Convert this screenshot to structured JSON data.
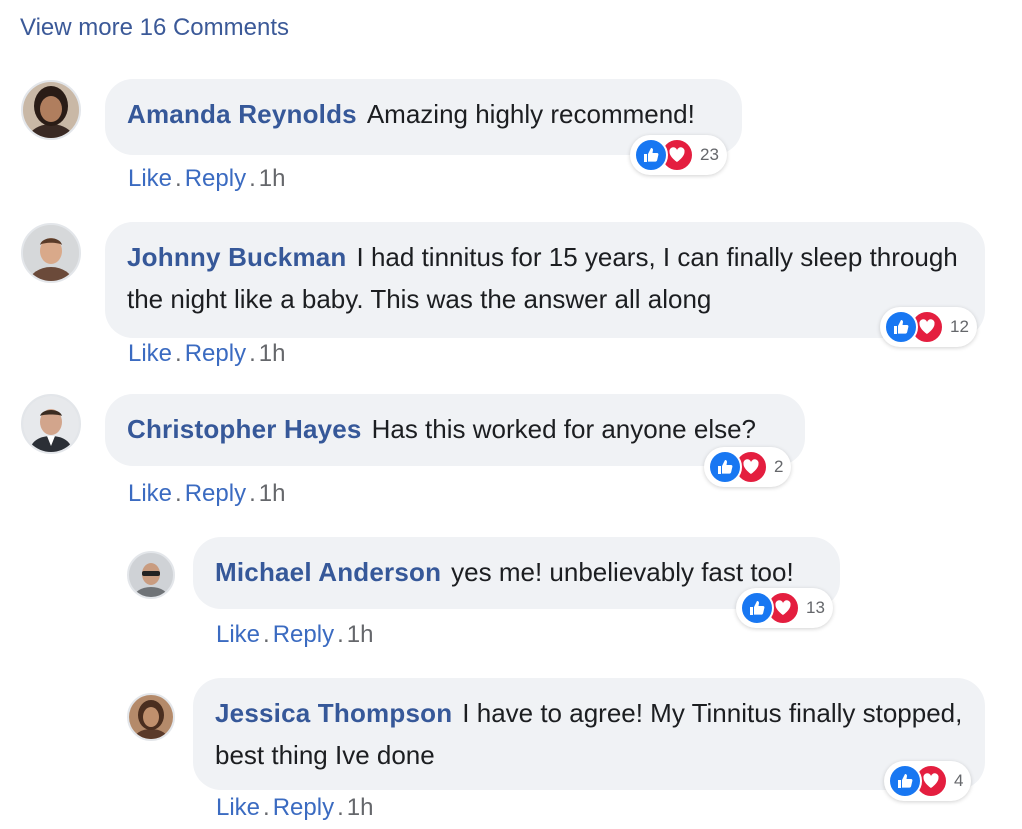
{
  "view_more": "View more 16 Comments",
  "separator": ".",
  "comments": [
    {
      "author": "Amanda Reynolds",
      "text": "Amazing highly recommend!",
      "reaction_count": "23",
      "like": "Like",
      "reply": "Reply",
      "time": "1h"
    },
    {
      "author": "Johnny Buckman",
      "text": "I had tinnitus for 15 years, I can finally sleep through the night like a baby. This was the answer all along",
      "reaction_count": "12",
      "like": "Like",
      "reply": "Reply",
      "time": "1h"
    },
    {
      "author": "Christopher Hayes",
      "text": "Has this worked for anyone else?",
      "reaction_count": "2",
      "like": "Like",
      "reply": "Reply",
      "time": "1h"
    },
    {
      "author": "Michael Anderson",
      "text": "yes me! unbelievably fast too!",
      "reaction_count": "13",
      "like": "Like",
      "reply": "Reply",
      "time": "1h"
    },
    {
      "author": "Jessica Thompson",
      "text": "I have to agree! My Tinnitus finally stopped, best thing Ive done",
      "reaction_count": "4",
      "like": "Like",
      "reply": "Reply",
      "time": "1h"
    }
  ],
  "colors": {
    "link": "#3b5998",
    "name": "#365899",
    "bubble": "#f0f2f5",
    "like_reaction": "#1877f2",
    "love_reaction": "#e41e3f"
  },
  "icons": {
    "like_reaction": "thumbs-up-icon",
    "love_reaction": "heart-icon"
  }
}
